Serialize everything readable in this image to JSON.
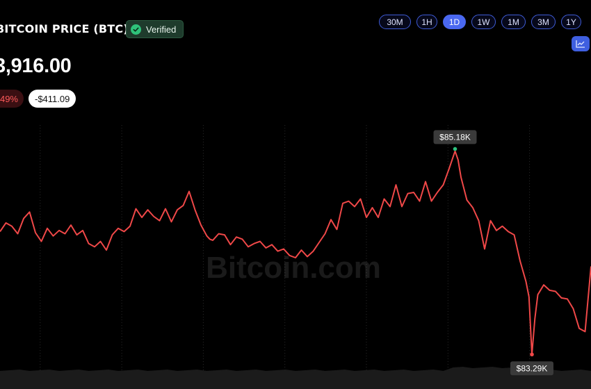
{
  "header": {
    "title": "BITCOIN PRICE (BTC)",
    "verified_label": "Verified"
  },
  "price": {
    "current": "3,916.00",
    "change_pct": "49%",
    "change_abs": "-$411.09"
  },
  "ranges": [
    "30M",
    "1H",
    "1D",
    "1W",
    "1M",
    "3M",
    "1Y"
  ],
  "active_range": "1D",
  "icons": {
    "verified": "check-circle-icon",
    "chart_type": "line-chart-icon"
  },
  "colors": {
    "line": "#f04848",
    "high_dot": "#2ec27e",
    "accent": "#4a68f0",
    "background": "#000000"
  },
  "watermark": "Bitcoin.com",
  "chart_data": {
    "type": "line",
    "title": "",
    "xlabel": "",
    "ylabel": "",
    "ylim": [
      83100,
      85400
    ],
    "grid": "vertical dotted",
    "annotations": [
      {
        "label": "$85.18K",
        "x": 0.77,
        "y": 85180,
        "kind": "high"
      },
      {
        "label": "$83.29K",
        "x": 0.9,
        "y": 83290,
        "kind": "low"
      }
    ],
    "series": [
      {
        "x": [
          0.0,
          0.01,
          0.02,
          0.03,
          0.04,
          0.05,
          0.06,
          0.07,
          0.08,
          0.09,
          0.1,
          0.11,
          0.12,
          0.13,
          0.14,
          0.15,
          0.16,
          0.17,
          0.18,
          0.19,
          0.2,
          0.21,
          0.22,
          0.23,
          0.24,
          0.25,
          0.26,
          0.27,
          0.28,
          0.29,
          0.3,
          0.31,
          0.32,
          0.33,
          0.34,
          0.35,
          0.355,
          0.36,
          0.37,
          0.38,
          0.39,
          0.4,
          0.41,
          0.42,
          0.43,
          0.44,
          0.45,
          0.46,
          0.47,
          0.48,
          0.49,
          0.5,
          0.51,
          0.52,
          0.53,
          0.54,
          0.55,
          0.56,
          0.57,
          0.58,
          0.59,
          0.6,
          0.61,
          0.62,
          0.63,
          0.64,
          0.65,
          0.66,
          0.67,
          0.68,
          0.69,
          0.7,
          0.71,
          0.72,
          0.73,
          0.74,
          0.75,
          0.76,
          0.77,
          0.775,
          0.78,
          0.79,
          0.8,
          0.81,
          0.82,
          0.83,
          0.84,
          0.85,
          0.86,
          0.87,
          0.88,
          0.89,
          0.895,
          0.9,
          0.905,
          0.91,
          0.92,
          0.93,
          0.94,
          0.95,
          0.96,
          0.97,
          0.98,
          0.99,
          1.0
        ],
        "y": [
          84420,
          84500,
          84470,
          84400,
          84540,
          84600,
          84410,
          84330,
          84450,
          84380,
          84430,
          84400,
          84480,
          84390,
          84430,
          84310,
          84280,
          84330,
          84250,
          84390,
          84450,
          84420,
          84470,
          84630,
          84550,
          84620,
          84560,
          84520,
          84630,
          84510,
          84620,
          84660,
          84790,
          84620,
          84480,
          84380,
          84350,
          84340,
          84400,
          84390,
          84300,
          84370,
          84350,
          84280,
          84310,
          84330,
          84270,
          84300,
          84240,
          84260,
          84200,
          84180,
          84250,
          84190,
          84240,
          84320,
          84400,
          84530,
          84440,
          84680,
          84700,
          84650,
          84720,
          84550,
          84640,
          84550,
          84720,
          84650,
          84850,
          84650,
          84770,
          84780,
          84700,
          84880,
          84700,
          84780,
          84850,
          85000,
          85160,
          85080,
          84920,
          84710,
          84640,
          84520,
          84260,
          84520,
          84430,
          84470,
          84420,
          84390,
          84150,
          83960,
          83820,
          83290,
          83620,
          83840,
          83930,
          83880,
          83870,
          83810,
          83800,
          83710,
          83530,
          83500,
          84100
        ]
      }
    ]
  }
}
